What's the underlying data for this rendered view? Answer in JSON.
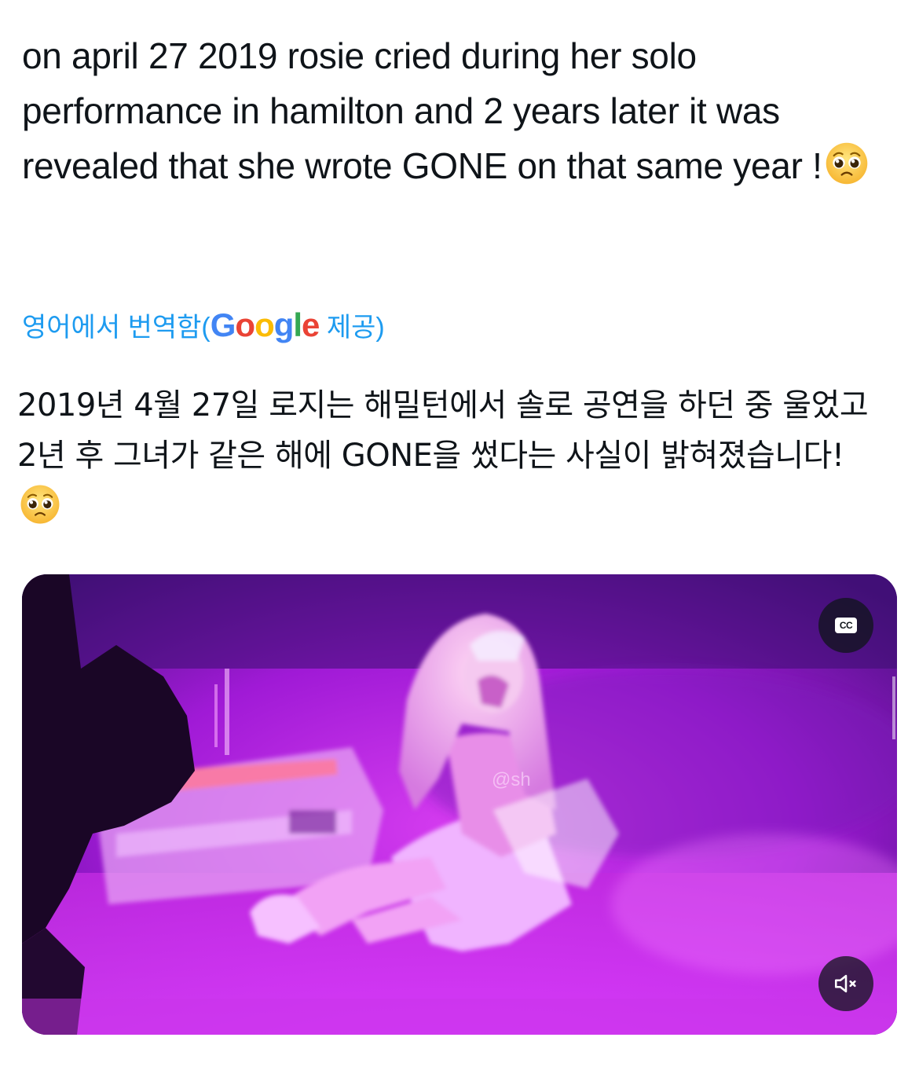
{
  "tweet": {
    "text": "on april 27 2019 rosie cried during her solo performance in hamilton and 2 years later it was revealed that she wrote GONE on that same year !",
    "emoji": "pleading-face-emoji"
  },
  "translation": {
    "link_prefix": "영어에서 번역함(",
    "provider": "Google",
    "link_suffix": " 제공)",
    "translated_text": "2019년 4월 27일 로지는 해밀턴에서 솔로 공연을 하던 중 울었고 2년 후 그녀가 같은 해에 GONE을 썼다는 사실이 밝혀졌습니다! ",
    "emoji": "pleading-face-emoji"
  },
  "media": {
    "type": "video",
    "watermark": "@sh",
    "cc_label": "CC",
    "cc_icon": "closed-captions-icon",
    "mute_icon": "speaker-muted-icon"
  },
  "colors": {
    "link": "#1d9bf0",
    "text": "#0f1419",
    "video_tint": "#a21cd8"
  }
}
